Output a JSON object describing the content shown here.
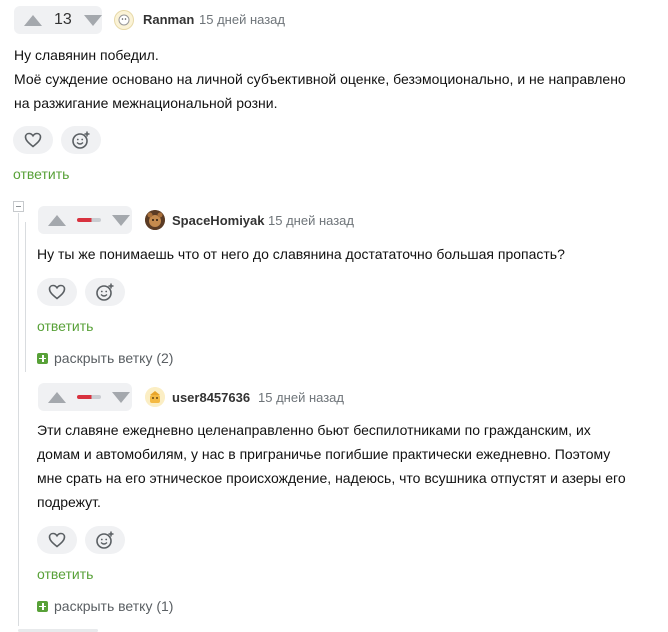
{
  "comments": [
    {
      "vote": "13",
      "username": "Ranman",
      "time": "15 дней назад",
      "lines": [
        "Ну славянин победил.",
        "Моё суждение основано на личной субъективной оценке, безэмоционально, и не направлено",
        "на разжигание межнациональной розни."
      ],
      "reply": "ответить"
    },
    {
      "username": "SpaceHomiyak",
      "time": "15 дней назад",
      "lines": [
        "Ну ты же понимаешь что от него до славянина достататочно большая пропасть?"
      ],
      "reply": "ответить",
      "expand": "раскрыть ветку (2)",
      "negative_share": 0.6
    },
    {
      "username": "user8457636",
      "time": "15 дней назад",
      "lines": [
        "Эти славяне ежедневно целенаправленно бьют беспилотниками по гражданским, их",
        "домам и автомобилям, у нас в приграничье погибшие практически ежедневно. Поэтому",
        "мне срать на его этническое происхождение, надеюсь, что всушника отпустят и азеры его",
        "подрежут."
      ],
      "reply": "ответить",
      "expand": "раскрыть ветку (1)",
      "negative_share": 0.6
    }
  ],
  "icons": {
    "upvote": "arrow-up-icon",
    "downvote": "arrow-down-icon",
    "like": "heart-icon",
    "reaction": "smiley-plus-icon",
    "collapse": "minus-square-icon",
    "expand": "plus-square-icon"
  },
  "colors": {
    "accent_green": "#58a138",
    "negative_red": "#d8323f",
    "control_bg": "#f0f1f3"
  }
}
